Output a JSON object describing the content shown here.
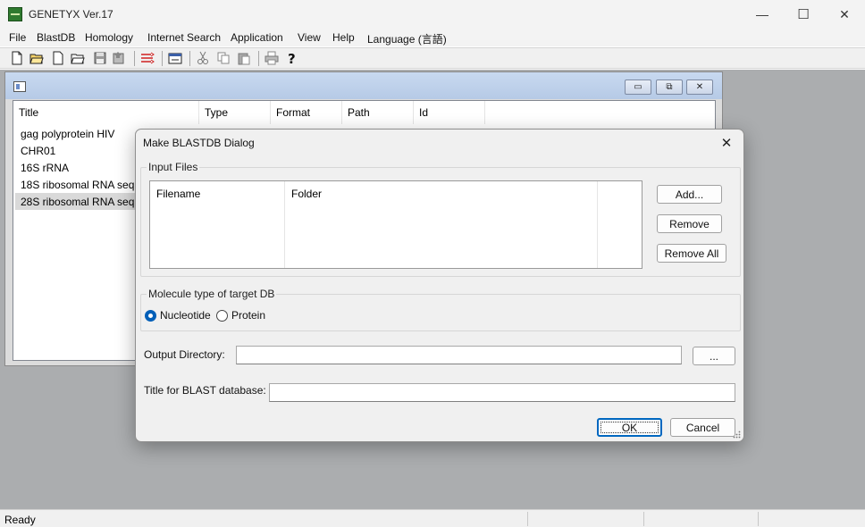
{
  "app": {
    "title": "GENETYX Ver.17"
  },
  "window_controls": {
    "minimize": "—",
    "maximize": "☐",
    "close": "✕"
  },
  "menu": [
    {
      "label": "File"
    },
    {
      "label": "BlastDB"
    },
    {
      "label": "Homology"
    },
    {
      "label": "Internet Search"
    },
    {
      "label": "Application"
    },
    {
      "label": "View"
    },
    {
      "label": "Help"
    },
    {
      "label": "Language (言語)"
    }
  ],
  "toolbar": {
    "icons": [
      "new-file-icon",
      "open-folder-icon",
      "new-document-icon",
      "open-document-icon",
      "save-icon",
      "save-as-icon",
      "align-icon",
      "keyboard-icon",
      "cut-icon",
      "copy-icon",
      "paste-icon",
      "print-icon",
      "help-icon"
    ]
  },
  "mdi_window": {
    "buttons": {
      "minimize": "▭",
      "restore": "⧉",
      "close": "✕"
    },
    "list": {
      "columns": [
        "Title",
        "Type",
        "Format",
        "Path",
        "Id"
      ],
      "rows": [
        {
          "title": "gag polyprotein HIV",
          "selected": false
        },
        {
          "title": "CHR01",
          "selected": false
        },
        {
          "title": "16S rRNA",
          "selected": false
        },
        {
          "title": "18S ribosomal RNA sequ",
          "selected": false
        },
        {
          "title": "28S ribosomal RNA sequ",
          "selected": true
        }
      ]
    }
  },
  "dialog": {
    "title": "Make BLASTDB Dialog",
    "close": "✕",
    "input_files": {
      "label": "Input Files",
      "columns": [
        "Filename",
        "Folder"
      ],
      "buttons": {
        "add": "Add...",
        "remove": "Remove",
        "remove_all": "Remove All"
      }
    },
    "molecule": {
      "label": "Molecule type of target DB",
      "options": [
        {
          "label": "Nucleotide",
          "checked": true
        },
        {
          "label": "Protein",
          "checked": false
        }
      ]
    },
    "output_dir": {
      "label": "Output Directory:",
      "value": "",
      "browse": "..."
    },
    "db_title": {
      "label": "Title for BLAST database:",
      "value": ""
    },
    "ok": "OK",
    "cancel": "Cancel"
  },
  "status": {
    "text": "Ready"
  },
  "colors": {
    "accent": "#005fb8",
    "workspace": "#abadaf",
    "selection": "#d9d9d9",
    "app_icon": "#2f7a2f"
  }
}
